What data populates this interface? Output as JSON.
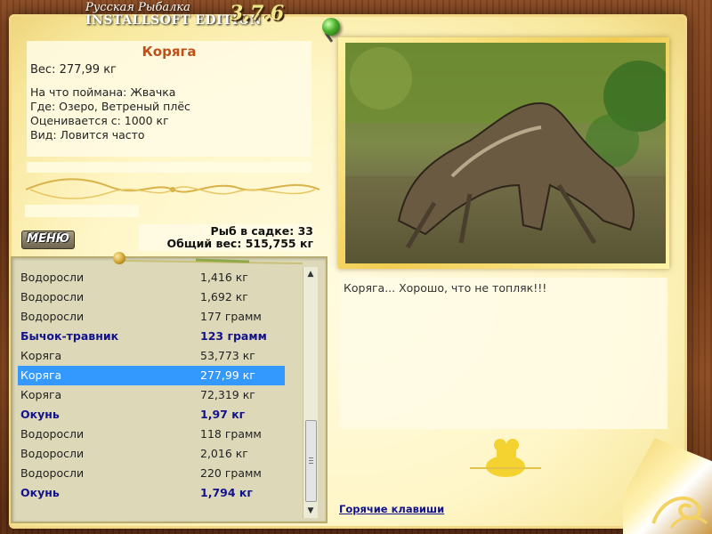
{
  "window": {
    "title_line1": "Русская Рыбалка",
    "title_line2": "INSTALLSOFT EDITION",
    "version": "3.7.6"
  },
  "fish_info": {
    "name": "Коряга",
    "weight_line": "Вес: 277,99 кг",
    "bait_line": "На что поймана: Жвачка",
    "place_line": "Где: Озеро, Ветреный плёс",
    "value_line": "Оценивается с: 1000 кг",
    "kind_line": "Вид: Ловится часто"
  },
  "menu_button": {
    "label": "МЕНЮ"
  },
  "stats": {
    "fish_in_keepnet": "Рыб в садке: 33",
    "total_weight": "Общий вес: 515,755 кг"
  },
  "catch_list": {
    "rows": [
      {
        "name": "Водоросли",
        "weight": "1,416 кг",
        "bold": false,
        "selected": false
      },
      {
        "name": "Водоросли",
        "weight": "1,692 кг",
        "bold": false,
        "selected": false
      },
      {
        "name": "Водоросли",
        "weight": "177 грамм",
        "bold": false,
        "selected": false
      },
      {
        "name": "Бычок-травник",
        "weight": "123 грамм",
        "bold": true,
        "selected": false
      },
      {
        "name": "Коряга",
        "weight": "53,773 кг",
        "bold": false,
        "selected": false
      },
      {
        "name": "Коряга",
        "weight": "277,99 кг",
        "bold": false,
        "selected": true
      },
      {
        "name": "Коряга",
        "weight": "72,319 кг",
        "bold": false,
        "selected": false
      },
      {
        "name": "Окунь",
        "weight": "1,97 кг",
        "bold": true,
        "selected": false
      },
      {
        "name": "Водоросли",
        "weight": "118 грамм",
        "bold": false,
        "selected": false
      },
      {
        "name": "Водоросли",
        "weight": "2,016 кг",
        "bold": false,
        "selected": false
      },
      {
        "name": "Водоросли",
        "weight": "220 грамм",
        "bold": false,
        "selected": false
      },
      {
        "name": "Окунь",
        "weight": "1,794 кг",
        "bold": true,
        "selected": false
      }
    ],
    "scrollbar_icons": {
      "up": "scroll-up-arrow-icon",
      "down": "scroll-down-arrow-icon"
    }
  },
  "comment": {
    "text": "Коряга... Хорошо, что не топляк!!!"
  },
  "hotkeys_link": "Горячие клавиши",
  "colors": {
    "fish_name": "#c0501a",
    "selected_row": "#3399ff",
    "bold_row": "#12128c",
    "link": "#12128c",
    "parchment": "#fff6c8",
    "wood": "#7a3d17"
  }
}
